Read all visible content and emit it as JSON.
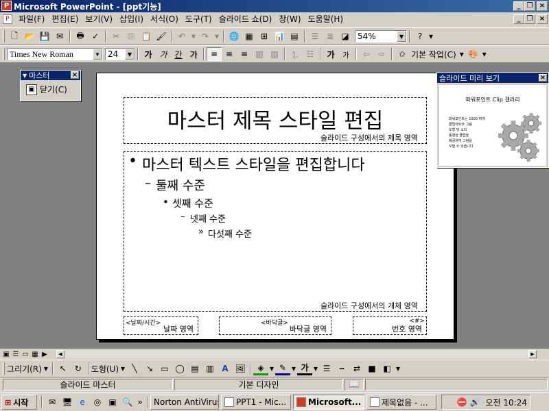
{
  "window": {
    "title": "Microsoft PowerPoint - [ppt기능]",
    "app_icon": "P",
    "minimize": "_",
    "restore": "❐",
    "close": "×"
  },
  "menu": [
    "파일(F)",
    "편집(E)",
    "보기(V)",
    "삽입(I)",
    "서식(O)",
    "도구(T)",
    "슬라이드 쇼(D)",
    "창(W)",
    "도움말(H)"
  ],
  "toolbar": {
    "zoom": "54%"
  },
  "format": {
    "font": "Times New Roman",
    "size": "24",
    "bold": "가",
    "italic": "가",
    "underline": "간",
    "shadow": "가",
    "grow": "가",
    "shrink": "가",
    "design_label": "기본 작업(C)"
  },
  "master_toolbar": {
    "title": "마스터",
    "close_label": "닫기(C)"
  },
  "slide": {
    "title": "마스터 제목 스타일 편집",
    "title_area": "슬라이드 구성에서의 제목 영역",
    "bullets": [
      "마스터 텍스트 스타일을 편집합니다",
      "둘째 수준",
      "셋째 수준",
      "넷째 수준",
      "다섯째 수준"
    ],
    "bullet_marks": [
      "•",
      "–",
      "•",
      "–",
      "»"
    ],
    "object_area": "슬라이드 구성에서의 개체 영역",
    "date_tag": "<날짜/시간>",
    "date_area": "날짜 영역",
    "footer_tag": "<바닥글>",
    "footer_area": "바닥글 영역",
    "number_tag": "<#>",
    "number_area": "번호 영역"
  },
  "preview": {
    "title": "슬라이드 미리 보기",
    "close": "×",
    "heading": "파워포인트 Clip 갤러리",
    "lines": [
      "파워포인트는 1000 여개",
      "클립아트와 그림",
      "도형 및 소리",
      "동영상 클립을",
      "제공하여 그림을",
      "꾸밀 수 있습니다"
    ]
  },
  "drawing": {
    "draw_label": "그리기(R)",
    "shapes_label": "도형(U)",
    "font_color": "가"
  },
  "status": {
    "view": "슬라이드 마스터",
    "design": "기본 디자인"
  },
  "taskbar": {
    "start": "시작",
    "chevron": "»",
    "tasks": [
      "Norton AntiVirus",
      "PPT1 - Mic...",
      "Microsoft...",
      "제목없음 - ..."
    ],
    "clock": "오전 10:24"
  }
}
